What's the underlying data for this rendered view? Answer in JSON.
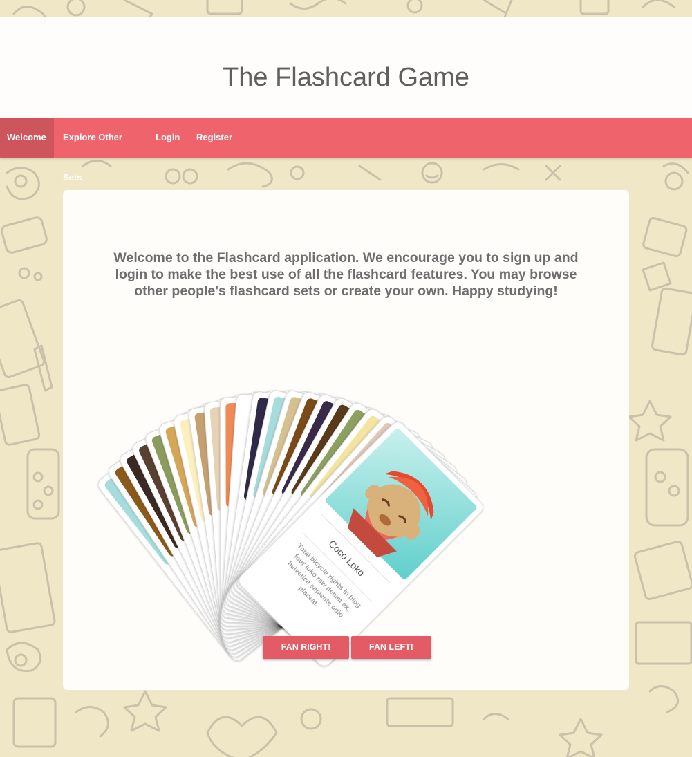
{
  "header": {
    "title": "The Flashcard Game"
  },
  "nav": {
    "items": [
      {
        "label": "Welcome",
        "active": true
      },
      {
        "label": "Explore Other Sets",
        "active": false
      },
      {
        "label": "Login",
        "active": false
      },
      {
        "label": "Register",
        "active": false
      }
    ]
  },
  "main": {
    "welcome_text": "Welcome to the Flashcard application. We encourage you to sign up and login to make the best use of all the flashcard features. You may browse other people's flashcard sets or create your own. Happy studying!",
    "front_card": {
      "title": "Coco Loko",
      "body_lines": [
        "Total bicycle rights in blog",
        "four loko raw denim ex,",
        "helvetica sapiente odio",
        "placeat."
      ]
    },
    "buttons": {
      "fan_right": "FAN RIGHT!",
      "fan_left": "FAN LEFT!"
    }
  },
  "colors": {
    "background": "#efe7c6",
    "doodle": "#c5b9a5",
    "nav": "#ef636c",
    "nav_active": "#cf555c",
    "button": "#e35b64",
    "title_text": "#5f5f5f",
    "body_text": "#6e6e6e",
    "card_tops": [
      "#a6dcdc",
      "#8a5a1a",
      "#3b2a24",
      "#5a4030",
      "#8c9c5c",
      "#d6a657",
      "#fdf0bd",
      "#c7a070",
      "#e6d2b4",
      "#f08a56",
      "#ffffff",
      "#2f2a48",
      "#a6dcdc",
      "#d6c090",
      "#7a4a18",
      "#3a2a4a",
      "#5a3a18",
      "#8ca060",
      "#f4e4a0",
      "#e0c8b8",
      "#6fd4d2"
    ]
  }
}
